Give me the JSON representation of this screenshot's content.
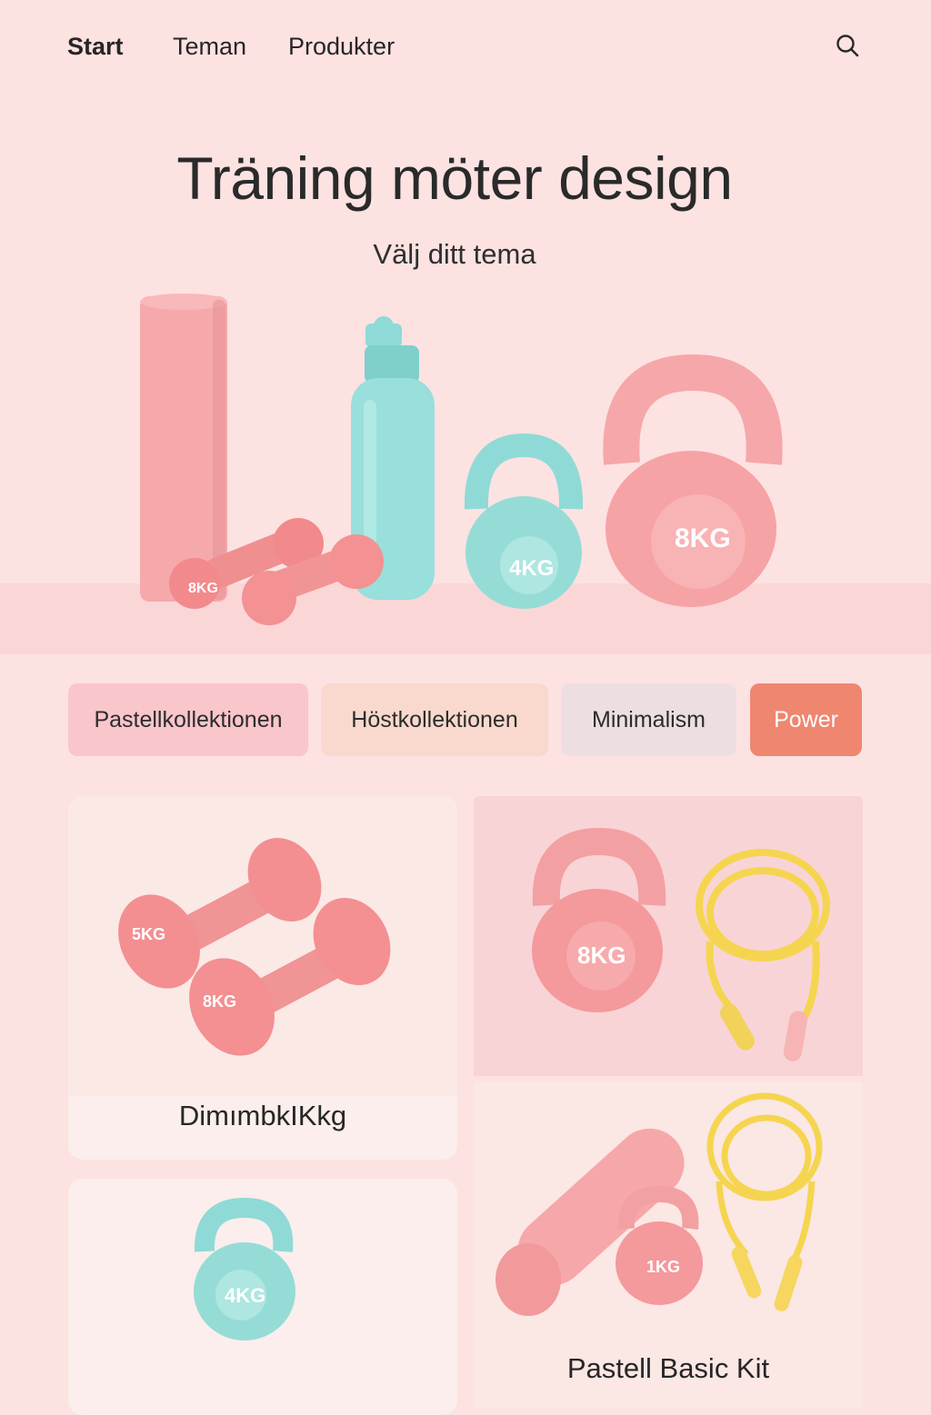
{
  "nav": {
    "items": [
      "Start",
      "Teman",
      "Produkter"
    ],
    "search_icon": "search-icon"
  },
  "hero": {
    "title": "Träning möter design",
    "subtitle": "Välj ditt tema",
    "weights": {
      "dumbbell": "8KG",
      "kettlebell_small": "4KG",
      "kettlebell_large": "8KG"
    }
  },
  "themes": [
    {
      "label": "Pastellkollektionen",
      "color": "#f9c6cb"
    },
    {
      "label": "Höstkollektionen",
      "color": "#f9d9cd"
    },
    {
      "label": "Minimalism",
      "color": "#eddfe1"
    },
    {
      "label": "Power",
      "color": "#ef8670"
    }
  ],
  "products": [
    {
      "label": "DimımbkIKkg",
      "weights": [
        "5KG",
        "8KG"
      ]
    },
    {
      "label": "",
      "weights": [
        "8KG"
      ]
    },
    {
      "label": "",
      "weights": [
        "4KG"
      ]
    },
    {
      "label": "Pastell Basic Kit",
      "weights": [
        "1KG"
      ]
    }
  ],
  "colors": {
    "background": "#fde2e2",
    "pink": "#f2a0a4",
    "mint": "#8fdad6",
    "yellow": "#f6d85a",
    "accent": "#ef8670"
  }
}
